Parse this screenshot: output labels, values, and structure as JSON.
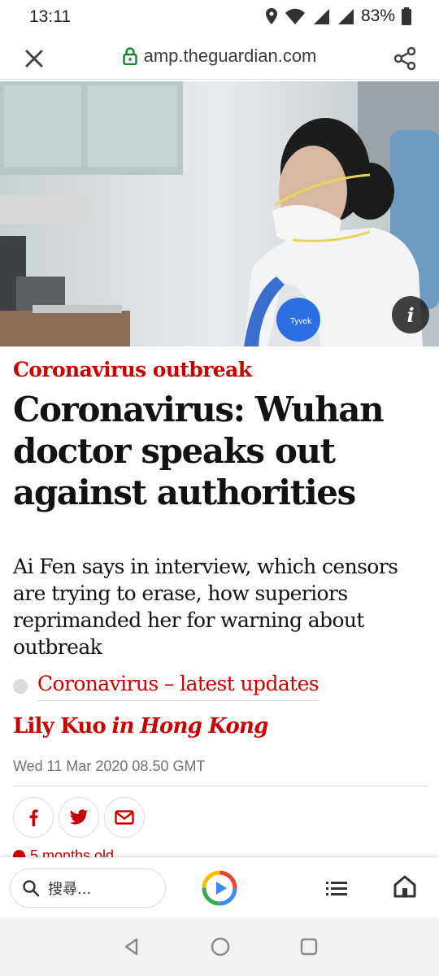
{
  "status": {
    "time": "13:11",
    "battery": "83%"
  },
  "browser": {
    "url": "amp.theguardian.com"
  },
  "article": {
    "kicker": "Coronavirus outbreak",
    "headline": "Coronavirus: Wuhan doctor speaks out against authorities",
    "standfirst": "Ai Fen says in interview, which censors are trying to erase, how superiors reprimanded her for warning about outbreak",
    "related_link": "Coronavirus – latest updates",
    "byline": {
      "author": "Lily Kuo",
      "in": "in",
      "place": "Hong Kong"
    },
    "date": "Wed 11 Mar 2020 08.50 GMT",
    "age": "5 months old",
    "hero_badge_text": "Tyvek",
    "hero_info_glyph": "i"
  },
  "google_bar": {
    "search_placeholder": "搜尋..."
  },
  "colors": {
    "guardian_red": "#c70000",
    "text": "#121212",
    "meta_gray": "#707070"
  },
  "icons": [
    "close-icon",
    "lock-icon",
    "share-icon",
    "info-icon",
    "facebook-icon",
    "twitter-icon",
    "email-icon",
    "clock-icon",
    "search-icon",
    "google-play-icon",
    "list-icon",
    "home-icon",
    "back-icon",
    "circle-home-icon",
    "recents-icon"
  ]
}
